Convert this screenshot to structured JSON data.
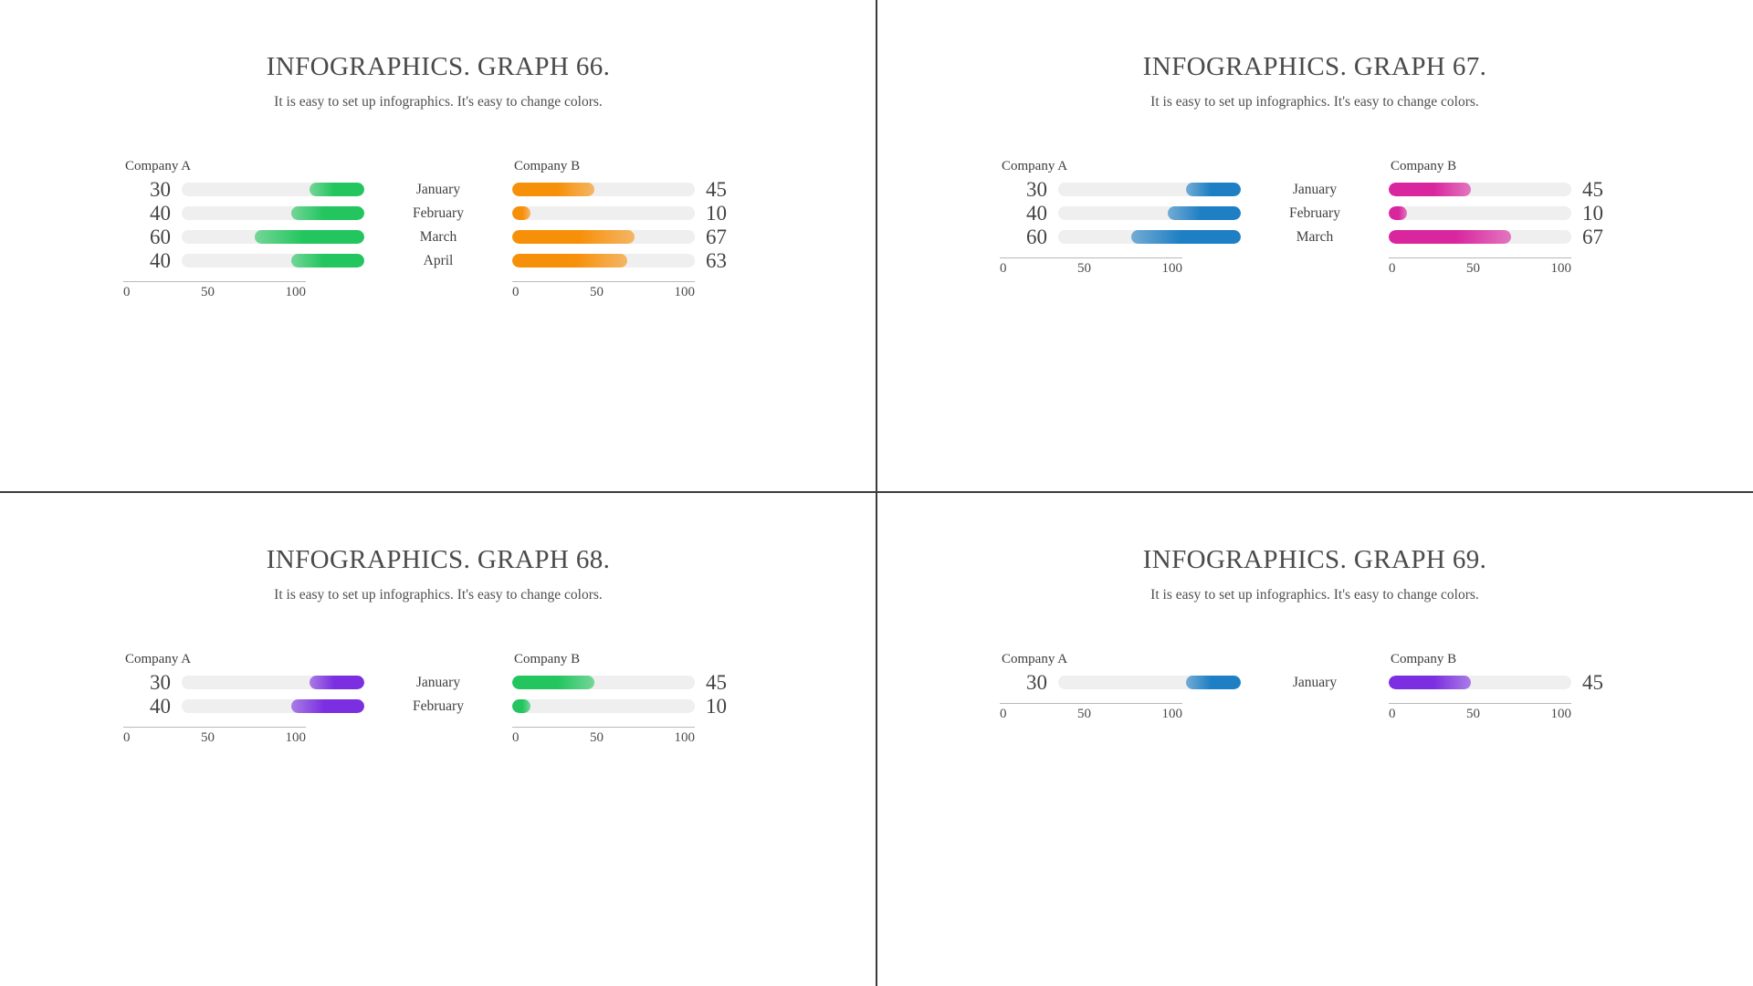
{
  "panels": [
    {
      "title": "INFOGRAPHICS. GRAPH 66.",
      "subtitle": "It is easy to set up infographics. It's easy to change colors.",
      "left_header": "Company A",
      "right_header": "Company B",
      "axis_ticks": [
        "0",
        "50",
        "100"
      ],
      "categories": [
        "January",
        "February",
        "March",
        "April"
      ],
      "left_values": [
        30,
        40,
        60,
        40
      ],
      "right_values": [
        45,
        10,
        67,
        63
      ],
      "left_color": "#22c55e",
      "right_color": "#f79009",
      "chart_data": {
        "type": "bar",
        "title": "INFOGRAPHICS. GRAPH 66.",
        "categories": [
          "January",
          "February",
          "March",
          "April"
        ],
        "series": [
          {
            "name": "Company A",
            "values": [
              30,
              40,
              60,
              40
            ],
            "color": "#22c55e",
            "align": "right"
          },
          {
            "name": "Company B",
            "values": [
              45,
              10,
              67,
              63
            ],
            "color": "#f79009",
            "align": "left"
          }
        ],
        "xlabel": "",
        "ylabel": "",
        "xlim": [
          0,
          100
        ],
        "grid": false,
        "legend": "none"
      }
    },
    {
      "title": "INFOGRAPHICS. GRAPH 67.",
      "subtitle": "It is easy to set up infographics. It's easy to change colors.",
      "left_header": "Company A",
      "right_header": "Company B",
      "axis_ticks": [
        "0",
        "50",
        "100"
      ],
      "categories": [
        "January",
        "February",
        "March"
      ],
      "left_values": [
        30,
        40,
        60
      ],
      "right_values": [
        45,
        10,
        67
      ],
      "left_color": "#1f7fc4",
      "right_color": "#d9269e",
      "chart_data": {
        "type": "bar",
        "title": "INFOGRAPHICS. GRAPH 67.",
        "categories": [
          "January",
          "February",
          "March"
        ],
        "series": [
          {
            "name": "Company A",
            "values": [
              30,
              40,
              60
            ],
            "color": "#1f7fc4",
            "align": "right"
          },
          {
            "name": "Company B",
            "values": [
              45,
              10,
              67
            ],
            "color": "#d9269e",
            "align": "left"
          }
        ],
        "xlabel": "",
        "ylabel": "",
        "xlim": [
          0,
          100
        ],
        "grid": false,
        "legend": "none"
      }
    },
    {
      "title": "INFOGRAPHICS. GRAPH 68.",
      "subtitle": "It is easy to set up infographics. It's easy to change colors.",
      "left_header": "Company A",
      "right_header": "Company B",
      "axis_ticks": [
        "0",
        "50",
        "100"
      ],
      "categories": [
        "January",
        "February"
      ],
      "left_values": [
        30,
        40
      ],
      "right_values": [
        45,
        10
      ],
      "left_color": "#7b2fe0",
      "right_color": "#22c55e",
      "chart_data": {
        "type": "bar",
        "title": "INFOGRAPHICS. GRAPH 68.",
        "categories": [
          "January",
          "February"
        ],
        "series": [
          {
            "name": "Company A",
            "values": [
              30,
              40
            ],
            "color": "#7b2fe0",
            "align": "right"
          },
          {
            "name": "Company B",
            "values": [
              45,
              10
            ],
            "color": "#22c55e",
            "align": "left"
          }
        ],
        "xlabel": "",
        "ylabel": "",
        "xlim": [
          0,
          100
        ],
        "grid": false,
        "legend": "none"
      }
    },
    {
      "title": "INFOGRAPHICS. GRAPH 69.",
      "subtitle": "It is easy to set up infographics. It's easy to change colors.",
      "left_header": "Company A",
      "right_header": "Company B",
      "axis_ticks": [
        "0",
        "50",
        "100"
      ],
      "categories": [
        "January"
      ],
      "left_values": [
        30
      ],
      "right_values": [
        45
      ],
      "left_color": "#1f7fc4",
      "right_color": "#7b2fe0",
      "chart_data": {
        "type": "bar",
        "title": "INFOGRAPHICS. GRAPH 69.",
        "categories": [
          "January"
        ],
        "series": [
          {
            "name": "Company A",
            "values": [
              30
            ],
            "color": "#1f7fc4",
            "align": "right"
          },
          {
            "name": "Company B",
            "values": [
              45
            ],
            "color": "#7b2fe0",
            "align": "left"
          }
        ],
        "xlabel": "",
        "ylabel": "",
        "xlim": [
          0,
          100
        ],
        "grid": false,
        "legend": "none"
      }
    }
  ]
}
